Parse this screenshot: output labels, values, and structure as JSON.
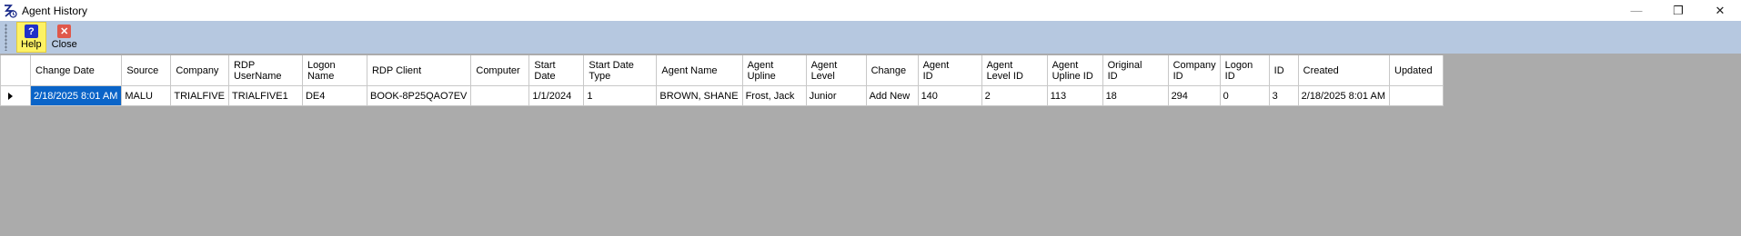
{
  "window": {
    "title": "Agent History",
    "title_icon": "agent-history-app-icon",
    "controls": {
      "minimize": "—",
      "restore": "❐",
      "close": "✕"
    }
  },
  "toolbar": {
    "help_label": "Help",
    "help_icon": "?",
    "close_label": "Close",
    "close_icon": "✕"
  },
  "table": {
    "columns": [
      "Change Date",
      "Source",
      "Company",
      "RDP UserName",
      "Logon Name",
      "RDP Client",
      "Computer",
      "Start Date",
      "Start Date Type",
      "Agent Name",
      "Agent Upline",
      "Agent Level",
      "Change",
      "Agent ID",
      "Agent Level ID",
      "Agent Upline ID",
      "Original ID",
      "Company ID",
      "Logon ID",
      "ID",
      "Created",
      "Updated"
    ],
    "header_lines": [
      [
        "Change Date"
      ],
      [
        "Source"
      ],
      [
        "Company"
      ],
      [
        "RDP",
        "UserName"
      ],
      [
        "Logon",
        "Name"
      ],
      [
        "RDP Client"
      ],
      [
        "Computer"
      ],
      [
        "Start",
        "Date"
      ],
      [
        "Start Date",
        "Type"
      ],
      [
        "Agent Name"
      ],
      [
        "Agent",
        "Upline"
      ],
      [
        "Agent",
        "Level"
      ],
      [
        "Change"
      ],
      [
        "Agent",
        "ID"
      ],
      [
        "Agent",
        "Level ID"
      ],
      [
        "Agent",
        "Upline ID"
      ],
      [
        "Original",
        "ID"
      ],
      [
        "Company",
        "ID"
      ],
      [
        "Logon",
        "ID"
      ],
      [
        "ID"
      ],
      [
        "Created"
      ],
      [
        "Updated"
      ]
    ],
    "rows": [
      [
        "2/18/2025 8:01 AM",
        "MALU",
        "TRIALFIVE",
        "TRIALFIVE1",
        "DE4",
        "BOOK-8P25QAO7EV",
        "",
        "1/1/2024",
        "1",
        "BROWN, SHANE",
        "Frost, Jack",
        "Junior",
        "Add New",
        "140",
        "2",
        "113",
        "18",
        "294",
        "0",
        "3",
        "2/18/2025 8:01 AM",
        ""
      ]
    ]
  }
}
